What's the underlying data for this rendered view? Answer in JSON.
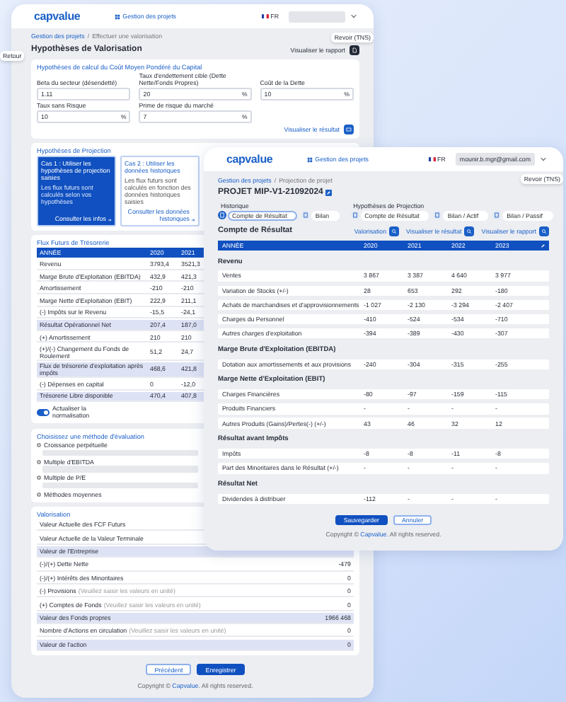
{
  "back": {
    "logo": "capvalue",
    "nav": "Gestion des projets",
    "lang": "FR",
    "side_tab_left": "Retour",
    "side_tab_right": "Revoir (TNS)",
    "breadcrumb": [
      "Gestion des projets",
      "Effectuer une valorisation"
    ],
    "breadcrumb_separator": "/",
    "title": "Hypothèses de Valorisation",
    "report_button": "Visualiser le rapport",
    "wacc": {
      "title": "Hypothèses de calcul du Coût Moyen Pondéré du Capital",
      "fields": [
        {
          "label": "Beta du secteur (désendetté)",
          "value": "1.11"
        },
        {
          "label": "Taux d'endettement cible (Dette Nette/Fonds Propres)",
          "value": "20",
          "unit": "%"
        },
        {
          "label": "Coût de la Dette",
          "value": "10",
          "unit": "%"
        },
        {
          "label": "Taux sans Risque",
          "value": "10",
          "unit": "%"
        },
        {
          "label": "Prime de risque du marché",
          "value": "7",
          "unit": "%"
        }
      ],
      "result_button": "Visualiser le résultat"
    },
    "projection": {
      "title": "Hypothèses de Projection",
      "options": [
        {
          "title": "Cas 1 : Utiliser les hypothèses de projection saisies",
          "text": "Les flux futurs sont calculés selon vos hypothèses",
          "link": "Consulter les infos",
          "selected": true
        },
        {
          "title": "Cas 2 : Utiliser les données historiques",
          "text": "Les flux futurs sont calculés en fonction des données historiques saisies",
          "link": "Consulter les données historiques",
          "selected": false
        }
      ]
    },
    "cashflows": {
      "title": "Flux Futurs de Trésorerie",
      "columns": [
        "ANNÉE",
        "2020",
        "2021"
      ],
      "rows": [
        {
          "label": "Revenu",
          "values": [
            "3793,4",
            "3521,3"
          ],
          "highlighted": false
        },
        {
          "label": "Marge Brute d'Exploitation (EBITDA)",
          "values": [
            "432,9",
            "421,3"
          ],
          "highlighted": false
        },
        {
          "label": "Amortissement",
          "values": [
            "-210",
            "-210"
          ],
          "highlighted": false
        },
        {
          "label": "Marge Nette d'Exploitation (EBIT)",
          "values": [
            "222,9",
            "211,1"
          ],
          "highlighted": false
        },
        {
          "label": "(-) Impôts sur le Revenu",
          "values": [
            "-15,5",
            "-24,1"
          ],
          "highlighted": false
        },
        {
          "label": "Résultat Opérationnel Net",
          "values": [
            "207,4",
            "187,0"
          ],
          "highlighted": true
        },
        {
          "label": "(+) Amortissement",
          "values": [
            "210",
            "210"
          ],
          "highlighted": false
        },
        {
          "label": "(+)/(-) Changement du Fonds de Roulement",
          "values": [
            "51,2",
            "24,7"
          ],
          "highlighted": false
        },
        {
          "label": "Flux de trésorerie d'exploitation après impôts",
          "values": [
            "468,6",
            "421,8"
          ],
          "highlighted": true
        },
        {
          "label": "(-) Dépenses en capital",
          "values": [
            "0",
            "-12,0"
          ],
          "highlighted": false
        },
        {
          "label": "Trésorerie Libre disponible",
          "values": [
            "470,4",
            "407,8"
          ],
          "highlighted": true
        }
      ],
      "toggle": {
        "label": "Actualiser la normalisation",
        "on": true
      }
    },
    "methods": {
      "title": "Choisissez une méthode d'évaluation",
      "options": [
        {
          "label": "Croissance perpétuelle",
          "selected": false,
          "kind": "field"
        },
        {
          "label": "Multiple d'EBITDA",
          "selected": false,
          "kind": "field"
        },
        {
          "label": "Multiple de P/E",
          "selected": false,
          "kind": "field"
        },
        {
          "label": "Méthodes moyennes",
          "selected": false,
          "kind": "plain"
        }
      ]
    },
    "valuation": {
      "title": "Valorisation",
      "rows": [
        {
          "label": "Valeur Actuelle des FCF Futurs",
          "highlighted": false
        },
        {
          "label": "Valeur Actuelle de la Valeur Terminale",
          "highlighted": false
        },
        {
          "label": "Valeur de l'Entreprise",
          "highlighted": true
        },
        {
          "label": "(-)/(+) Dette Nette",
          "value": "-479",
          "highlighted": false
        },
        {
          "label": "(-)/(+) Intérêts des Minoritaires",
          "value": "0",
          "highlighted": false
        },
        {
          "label": "(-) Provisions",
          "note": "(Veuillez saisir les valeurs en unité)",
          "value": "0",
          "highlighted": false
        },
        {
          "label": "(+) Comptes de Fonds",
          "note": "(Veuillez saisir les valeurs en unité)",
          "value": "0",
          "highlighted": false
        },
        {
          "label": "Valeur des Fonds propres",
          "value": "1966 468",
          "highlighted": true
        },
        {
          "label": "Nombre d'Actions en circulation",
          "note": "(Veuillez saisir les valeurs en unité)",
          "value": "0",
          "highlighted": false
        },
        {
          "label": "Valeur de l'action",
          "value": "0",
          "highlighted": true
        }
      ]
    },
    "buttons": [
      "Précédent",
      "Enregistrer"
    ],
    "footer": {
      "prefix": "Copyright ©",
      "link": "Capvalue",
      "suffix": ". All rights reserved."
    }
  },
  "front": {
    "logo": "capvalue",
    "nav": "Gestion des projets",
    "lang": "FR",
    "user": "mounir.b.mgr@gmail.com",
    "side_tab": "Revoir (TNS)",
    "breadcrumb": [
      "Gestion des projets",
      "Projection de projet"
    ],
    "breadcrumb_separator": "/",
    "title": "PROJET MIP-V1-21092024",
    "groups": [
      {
        "label": "Historique",
        "tabs": [
          {
            "label": "Compte de Résultat",
            "selected": true
          },
          {
            "label": "Bilan",
            "selected": false
          }
        ]
      },
      {
        "label": "Hypothèses de Projection",
        "tabs": [
          {
            "label": "Compte de Résultat",
            "selected": false
          },
          {
            "label": "Bilan / Actif",
            "selected": false
          },
          {
            "label": "Bilan / Passif",
            "selected": false
          }
        ]
      }
    ],
    "section_title": "Compte de Résultat",
    "actions": [
      "Valorisation",
      "Visualiser le résultat",
      "Visualiser le rapport"
    ],
    "columns": [
      "ANNÉE",
      "2020",
      "2021",
      "2022",
      "2023"
    ],
    "sections": [
      {
        "title": "Revenu",
        "rows": [
          {
            "label": "Ventes",
            "values": [
              "3 867",
              "3 387",
              "4 640",
              "3 977"
            ]
          },
          {
            "label": "Variation de Stocks (+/-)",
            "values": [
              "28",
              "653",
              "292",
              "-180"
            ]
          },
          {
            "label": "Achats de marchandises et d'approvisionnements",
            "values": [
              "-1 027",
              "-2 130",
              "-3 294",
              "-2 407"
            ]
          },
          {
            "label": "Charges du Personnel",
            "values": [
              "-410",
              "-524",
              "-534",
              "-710"
            ]
          },
          {
            "label": "Autres charges d'exploitation",
            "values": [
              "-394",
              "-389",
              "-430",
              "-307"
            ]
          }
        ]
      },
      {
        "title": "Marge Brute d'Exploitation (EBITDA)",
        "rows": [
          {
            "label": "Dotation aux amortissements et aux provisions",
            "values": [
              "-240",
              "-304",
              "-315",
              "-255"
            ]
          }
        ]
      },
      {
        "title": "Marge Nette d'Exploitation (EBIT)",
        "rows": [
          {
            "label": "Charges Financières",
            "values": [
              "-80",
              "-97",
              "-159",
              "-115"
            ]
          },
          {
            "label": "Produits Financiers",
            "values": [
              "-",
              "-",
              "-",
              "-"
            ]
          },
          {
            "label": "Autres Produits (Gains)/Pertes(-) (+/-)",
            "values": [
              "43",
              "46",
              "32",
              "12"
            ]
          }
        ]
      },
      {
        "title": "Résultat avant Impôts",
        "rows": [
          {
            "label": "Impôts",
            "values": [
              "-8",
              "-8",
              "-11",
              "-8"
            ]
          },
          {
            "label": "Part des Minoritaires dans le Résultat (+/-)",
            "values": [
              "-",
              "-",
              "-",
              "-"
            ]
          }
        ]
      },
      {
        "title": "Résultat Net",
        "rows": [
          {
            "label": "Dividendes à distribuer",
            "values": [
              "-112",
              "-",
              "-",
              "-"
            ]
          }
        ]
      }
    ],
    "buttons": [
      "Sauvegarder",
      "Annuler"
    ],
    "footer": {
      "prefix": "Copyright ©",
      "link": "Capvalue",
      "suffix": ". All rights reserved."
    }
  }
}
